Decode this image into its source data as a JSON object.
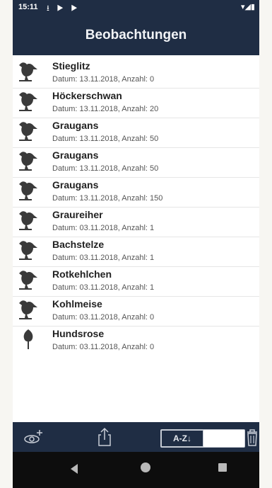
{
  "status": {
    "time": "15:11",
    "icons": "⭳ ▶ ▶",
    "signal": "▾◢▮"
  },
  "app": {
    "title": "Beobachtungen"
  },
  "observations": [
    {
      "name": "Stieglitz",
      "meta": "Datum: 13.11.2018, Anzahl: 0",
      "icon": "bird-icon"
    },
    {
      "name": "Höckerschwan",
      "meta": "Datum: 13.11.2018, Anzahl: 20",
      "icon": "bird-icon"
    },
    {
      "name": "Graugans",
      "meta": "Datum: 13.11.2018, Anzahl: 50",
      "icon": "bird-icon"
    },
    {
      "name": "Graugans",
      "meta": "Datum: 13.11.2018, Anzahl: 50",
      "icon": "bird-icon"
    },
    {
      "name": "Graugans",
      "meta": "Datum: 13.11.2018, Anzahl: 150",
      "icon": "bird-icon"
    },
    {
      "name": "Graureiher",
      "meta": "Datum: 03.11.2018, Anzahl: 1",
      "icon": "bird-icon"
    },
    {
      "name": "Bachstelze",
      "meta": "Datum: 03.11.2018, Anzahl: 1",
      "icon": "bird-icon"
    },
    {
      "name": "Rotkehlchen",
      "meta": "Datum: 03.11.2018, Anzahl: 1",
      "icon": "bird-icon"
    },
    {
      "name": "Kohlmeise",
      "meta": "Datum: 03.11.2018, Anzahl: 0",
      "icon": "bird-icon"
    },
    {
      "name": "Hundsrose",
      "meta": "Datum: 03.11.2018, Anzahl: 0",
      "icon": "plant-icon"
    }
  ],
  "toolbar": {
    "add_icon": "add-observation-icon",
    "share_icon": "share-icon",
    "sort_label": "A-Z↓",
    "delete_icon": "trash-icon"
  },
  "colors": {
    "bar": "#1f2d44",
    "frame": "#f7f6f2",
    "icon": "#3a3a3a"
  }
}
